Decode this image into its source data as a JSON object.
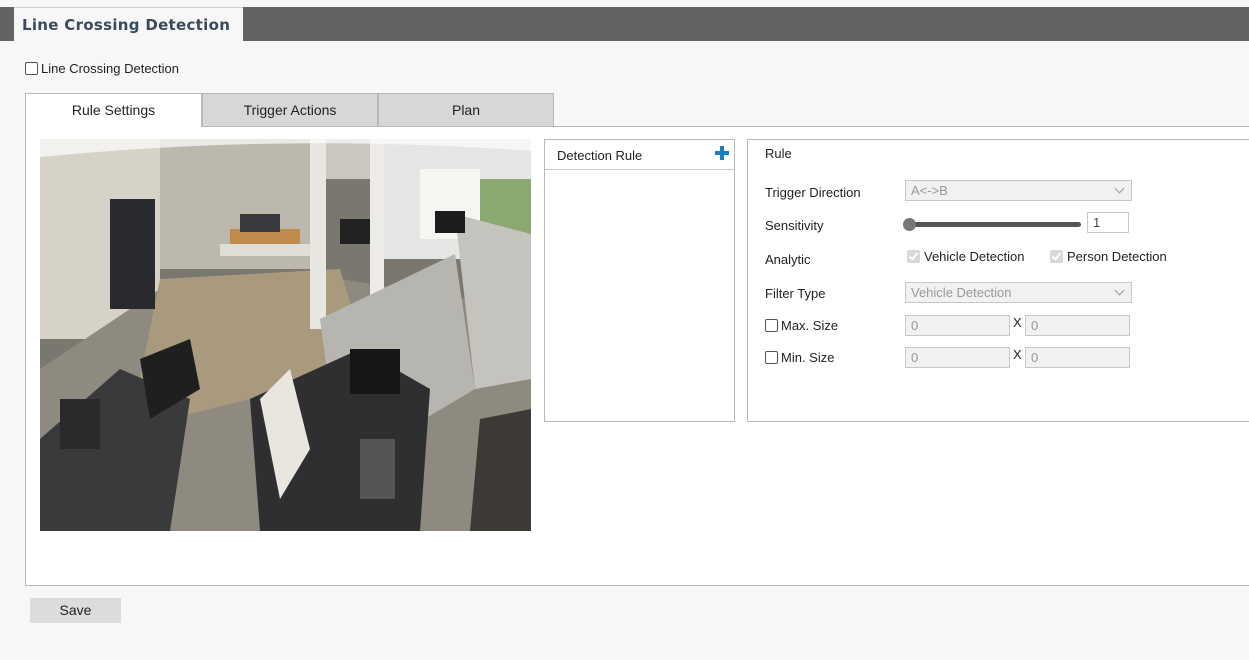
{
  "page": {
    "title": "Line Crossing Detection"
  },
  "enable": {
    "label": "Line Crossing Detection",
    "checked": false
  },
  "tabs": [
    {
      "label": "Rule Settings",
      "active": true
    },
    {
      "label": "Trigger Actions",
      "active": false
    },
    {
      "label": "Plan",
      "active": false
    }
  ],
  "detection_rule": {
    "header": "Detection Rule",
    "add_icon": "plus-icon"
  },
  "rule": {
    "title": "Rule",
    "trigger_direction": {
      "label": "Trigger Direction",
      "value": "A<->B"
    },
    "sensitivity": {
      "label": "Sensitivity",
      "value": "1"
    },
    "analytic": {
      "label": "Analytic",
      "options": [
        "Vehicle Detection",
        "Person Detection"
      ]
    },
    "filter_type": {
      "label": "Filter Type",
      "value": "Vehicle Detection"
    },
    "max_size": {
      "label": "Max. Size",
      "width": "0",
      "x": "X",
      "height": "0"
    },
    "min_size": {
      "label": "Min. Size",
      "width": "0",
      "x": "X",
      "height": "0"
    }
  },
  "save_label": "Save",
  "colors": {
    "header_bar": "#636363",
    "accent_plus": "#1a7fc1"
  }
}
